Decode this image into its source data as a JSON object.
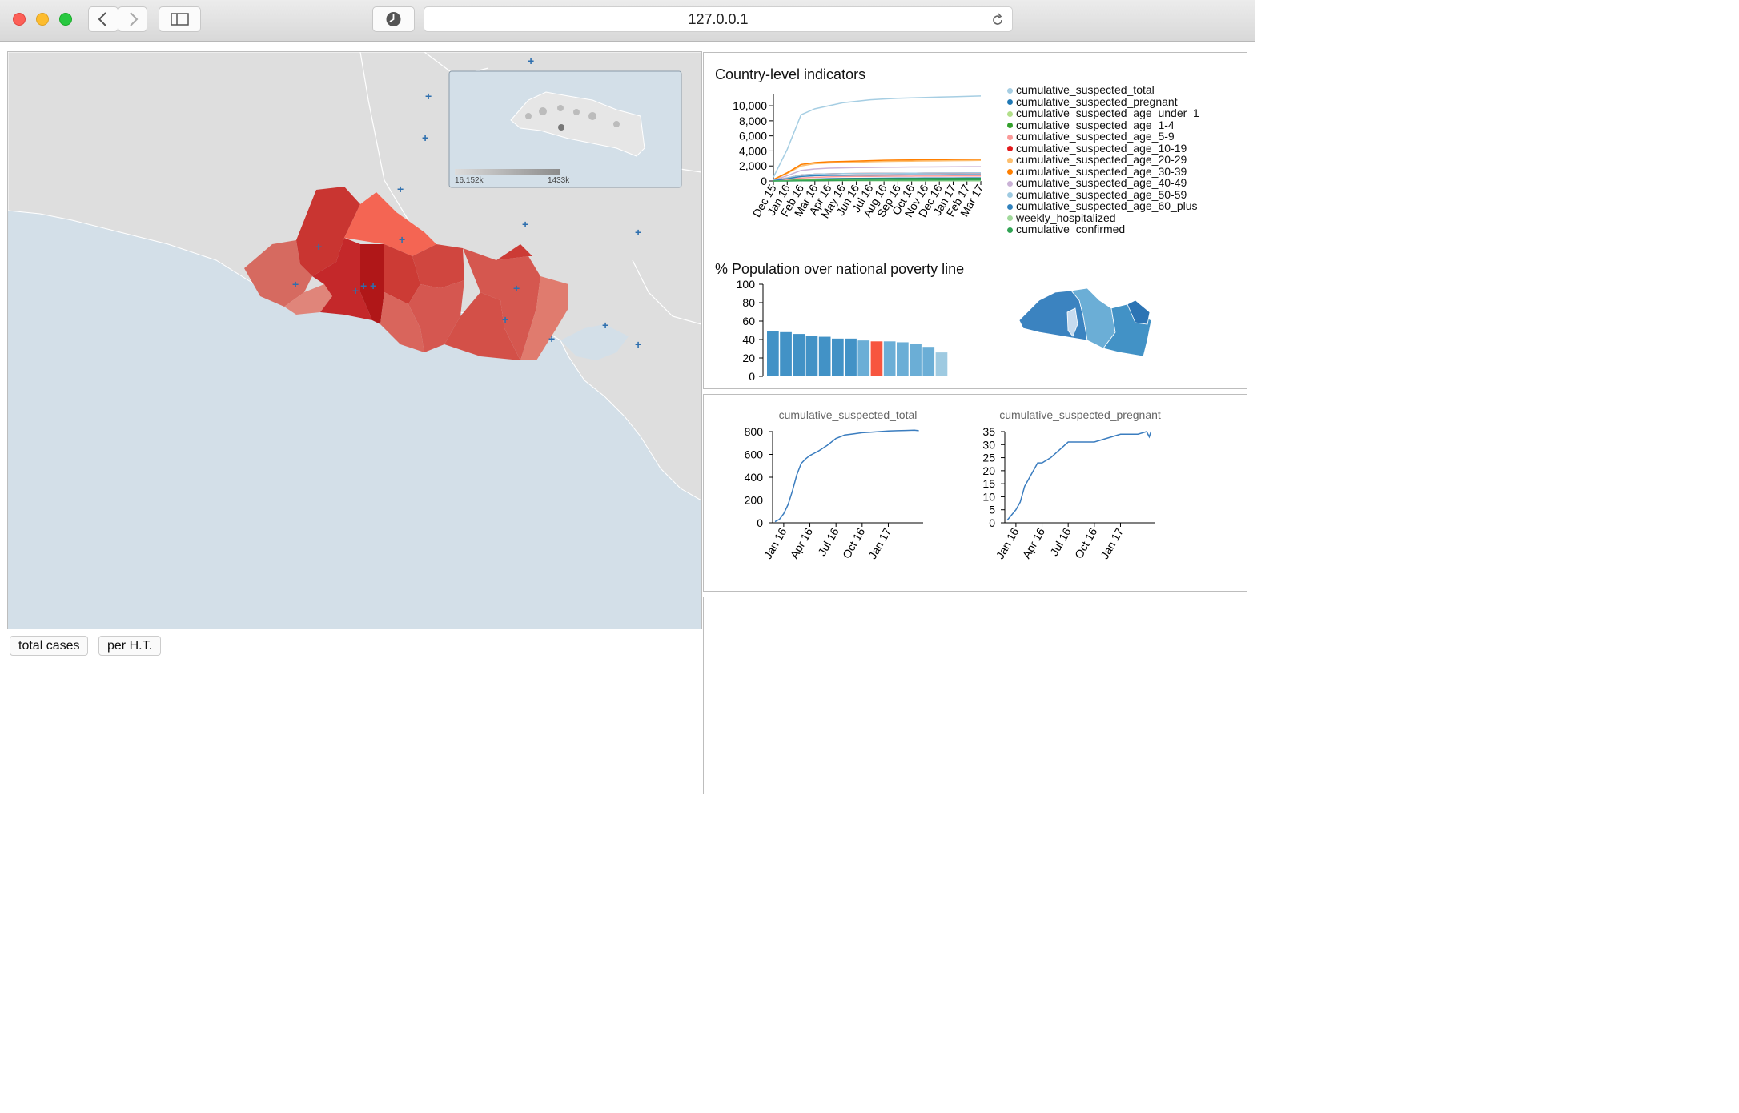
{
  "browser": {
    "url": "127.0.0.1",
    "colors": {
      "close": "#fc5f57",
      "minimize": "#fdbc2e",
      "zoom": "#28c840"
    }
  },
  "map": {
    "inset_scale": {
      "min_label": "16.152k",
      "max_label": "1433k"
    },
    "buttons": {
      "total_cases": "total cases",
      "per_ht": "per H.T."
    },
    "colors": {
      "ocean": "#d3dfe8",
      "land": "#dedede",
      "choropleth_dark": "#b31f1f",
      "choropleth_light": "#e07b6e",
      "marker": "#2e6fae"
    }
  },
  "indicators": {
    "title": "Country-level indicators",
    "legend": [
      {
        "name": "cumulative_suspected_total",
        "color": "#a6cee3"
      },
      {
        "name": "cumulative_suspected_pregnant",
        "color": "#1f78b4"
      },
      {
        "name": "cumulative_suspected_age_under_1",
        "color": "#b2df8a"
      },
      {
        "name": "cumulative_suspected_age_1-4",
        "color": "#33a02c"
      },
      {
        "name": "cumulative_suspected_age_5-9",
        "color": "#fb9a99"
      },
      {
        "name": "cumulative_suspected_age_10-19",
        "color": "#e31a1c"
      },
      {
        "name": "cumulative_suspected_age_20-29",
        "color": "#fdbf6f"
      },
      {
        "name": "cumulative_suspected_age_30-39",
        "color": "#ff7f00"
      },
      {
        "name": "cumulative_suspected_age_40-49",
        "color": "#cab2d6"
      },
      {
        "name": "cumulative_suspected_age_50-59",
        "color": "#9ecae1"
      },
      {
        "name": "cumulative_suspected_age_60_plus",
        "color": "#3182bd"
      },
      {
        "name": "weekly_hospitalized",
        "color": "#a1d99b"
      },
      {
        "name": "cumulative_confirmed",
        "color": "#31a354"
      }
    ]
  },
  "poverty": {
    "title": "% Population over national poverty line"
  },
  "chart_data": [
    {
      "type": "line",
      "title": "Country-level indicators",
      "x": [
        "Dec 15",
        "Jan 16",
        "Feb 16",
        "Mar 16",
        "Apr 16",
        "May 16",
        "Jun 16",
        "Jul 16",
        "Aug 16",
        "Sep 16",
        "Oct 16",
        "Nov 16",
        "Dec 16",
        "Jan 17",
        "Feb 17",
        "Mar 17"
      ],
      "yticks": [
        "0",
        "2,000",
        "4,000",
        "6,000",
        "8,000",
        "10,000"
      ],
      "ylim": [
        0,
        11500
      ],
      "series": [
        {
          "name": "cumulative_suspected_total",
          "values": [
            500,
            4200,
            8800,
            9600,
            10000,
            10400,
            10600,
            10800,
            10900,
            11000,
            11050,
            11100,
            11150,
            11200,
            11250,
            11300
          ]
        },
        {
          "name": "cumulative_suspected_pregnant",
          "values": [
            20,
            100,
            200,
            250,
            300,
            330,
            350,
            360,
            370,
            380,
            390,
            395,
            400,
            405,
            410,
            415
          ]
        },
        {
          "name": "cumulative_suspected_age_under_1",
          "values": [
            10,
            60,
            120,
            150,
            180,
            200,
            210,
            220,
            225,
            230,
            235,
            240,
            245,
            250,
            255,
            260
          ]
        },
        {
          "name": "cumulative_suspected_age_1-4",
          "values": [
            15,
            80,
            160,
            200,
            240,
            260,
            275,
            285,
            290,
            295,
            300,
            305,
            310,
            315,
            320,
            325
          ]
        },
        {
          "name": "cumulative_suspected_age_5-9",
          "values": [
            30,
            200,
            400,
            480,
            540,
            580,
            600,
            615,
            625,
            635,
            645,
            650,
            655,
            660,
            665,
            670
          ]
        },
        {
          "name": "cumulative_suspected_age_10-19",
          "values": [
            80,
            400,
            800,
            900,
            950,
            980,
            1000,
            1010,
            1020,
            1030,
            1040,
            1045,
            1050,
            1055,
            1060,
            1065
          ]
        },
        {
          "name": "cumulative_suspected_age_20-29",
          "values": [
            150,
            1000,
            2000,
            2300,
            2400,
            2450,
            2500,
            2550,
            2600,
            2620,
            2640,
            2660,
            2680,
            2700,
            2720,
            2740
          ]
        },
        {
          "name": "cumulative_suspected_age_30-39",
          "values": [
            200,
            1100,
            2200,
            2450,
            2550,
            2600,
            2650,
            2700,
            2750,
            2780,
            2800,
            2820,
            2840,
            2860,
            2880,
            2900
          ]
        },
        {
          "name": "cumulative_suspected_age_40-49",
          "values": [
            100,
            700,
            1400,
            1600,
            1700,
            1750,
            1780,
            1800,
            1820,
            1840,
            1860,
            1870,
            1880,
            1890,
            1900,
            1910
          ]
        },
        {
          "name": "cumulative_suspected_age_50-59",
          "values": [
            50,
            400,
            800,
            900,
            950,
            980,
            1000,
            1010,
            1020,
            1030,
            1040,
            1050,
            1060,
            1070,
            1080,
            1090
          ]
        },
        {
          "name": "cumulative_suspected_age_60_plus",
          "values": [
            40,
            300,
            600,
            700,
            740,
            760,
            780,
            790,
            800,
            810,
            820,
            825,
            830,
            835,
            840,
            845
          ]
        },
        {
          "name": "weekly_hospitalized",
          "values": [
            5,
            40,
            80,
            60,
            40,
            30,
            25,
            20,
            20,
            15,
            15,
            15,
            10,
            10,
            10,
            10
          ]
        },
        {
          "name": "cumulative_confirmed",
          "values": [
            0,
            5,
            20,
            40,
            60,
            80,
            90,
            100,
            110,
            115,
            120,
            125,
            130,
            135,
            140,
            145
          ]
        }
      ]
    },
    {
      "type": "bar",
      "title": "% Population over national poverty line",
      "yticks": [
        "0",
        "20",
        "40",
        "60",
        "80",
        "100"
      ],
      "ylim": [
        0,
        100
      ],
      "values": [
        49,
        48,
        46,
        44,
        43,
        41,
        41,
        39,
        38,
        38,
        37,
        35,
        32,
        26
      ],
      "colors": [
        "#4292c6",
        "#4292c6",
        "#4292c6",
        "#4292c6",
        "#4292c6",
        "#4292c6",
        "#4292c6",
        "#6baed6",
        "#f7553f",
        "#6baed6",
        "#6baed6",
        "#6baed6",
        "#6baed6",
        "#9ecae1"
      ]
    },
    {
      "type": "line",
      "title": "cumulative_suspected_total",
      "xticks": [
        "Jan 16",
        "Apr 16",
        "Jul 16",
        "Oct 16",
        "Jan 17"
      ],
      "yticks": [
        "0",
        "200",
        "400",
        "600",
        "800"
      ],
      "ylim": [
        0,
        800
      ],
      "x_months": [
        0,
        0.5,
        1,
        1.5,
        2,
        2.5,
        3,
        3.5,
        4,
        5,
        6,
        7,
        8,
        9,
        10,
        11,
        12,
        13,
        14,
        15,
        16,
        16.5
      ],
      "values": [
        10,
        30,
        80,
        160,
        280,
        420,
        520,
        560,
        590,
        630,
        680,
        740,
        770,
        780,
        790,
        795,
        800,
        805,
        808,
        810,
        812,
        808
      ]
    },
    {
      "type": "line",
      "title": "cumulative_suspected_pregnant",
      "xticks": [
        "Jan 16",
        "Apr 16",
        "Jul 16",
        "Oct 16",
        "Jan 17"
      ],
      "yticks": [
        "0",
        "5",
        "10",
        "15",
        "20",
        "25",
        "30",
        "35"
      ],
      "ylim": [
        0,
        35
      ],
      "x_months": [
        0,
        0.5,
        1,
        1.5,
        2,
        2.5,
        3,
        3.5,
        4,
        5,
        6,
        7,
        8,
        9,
        10,
        11,
        12,
        13,
        14,
        15,
        16,
        16.3,
        16.5
      ],
      "values": [
        1,
        3,
        5,
        8,
        14,
        17,
        20,
        23,
        23,
        25,
        28,
        31,
        31,
        31,
        31,
        32,
        33,
        34,
        34,
        34,
        35,
        33,
        35
      ]
    }
  ]
}
